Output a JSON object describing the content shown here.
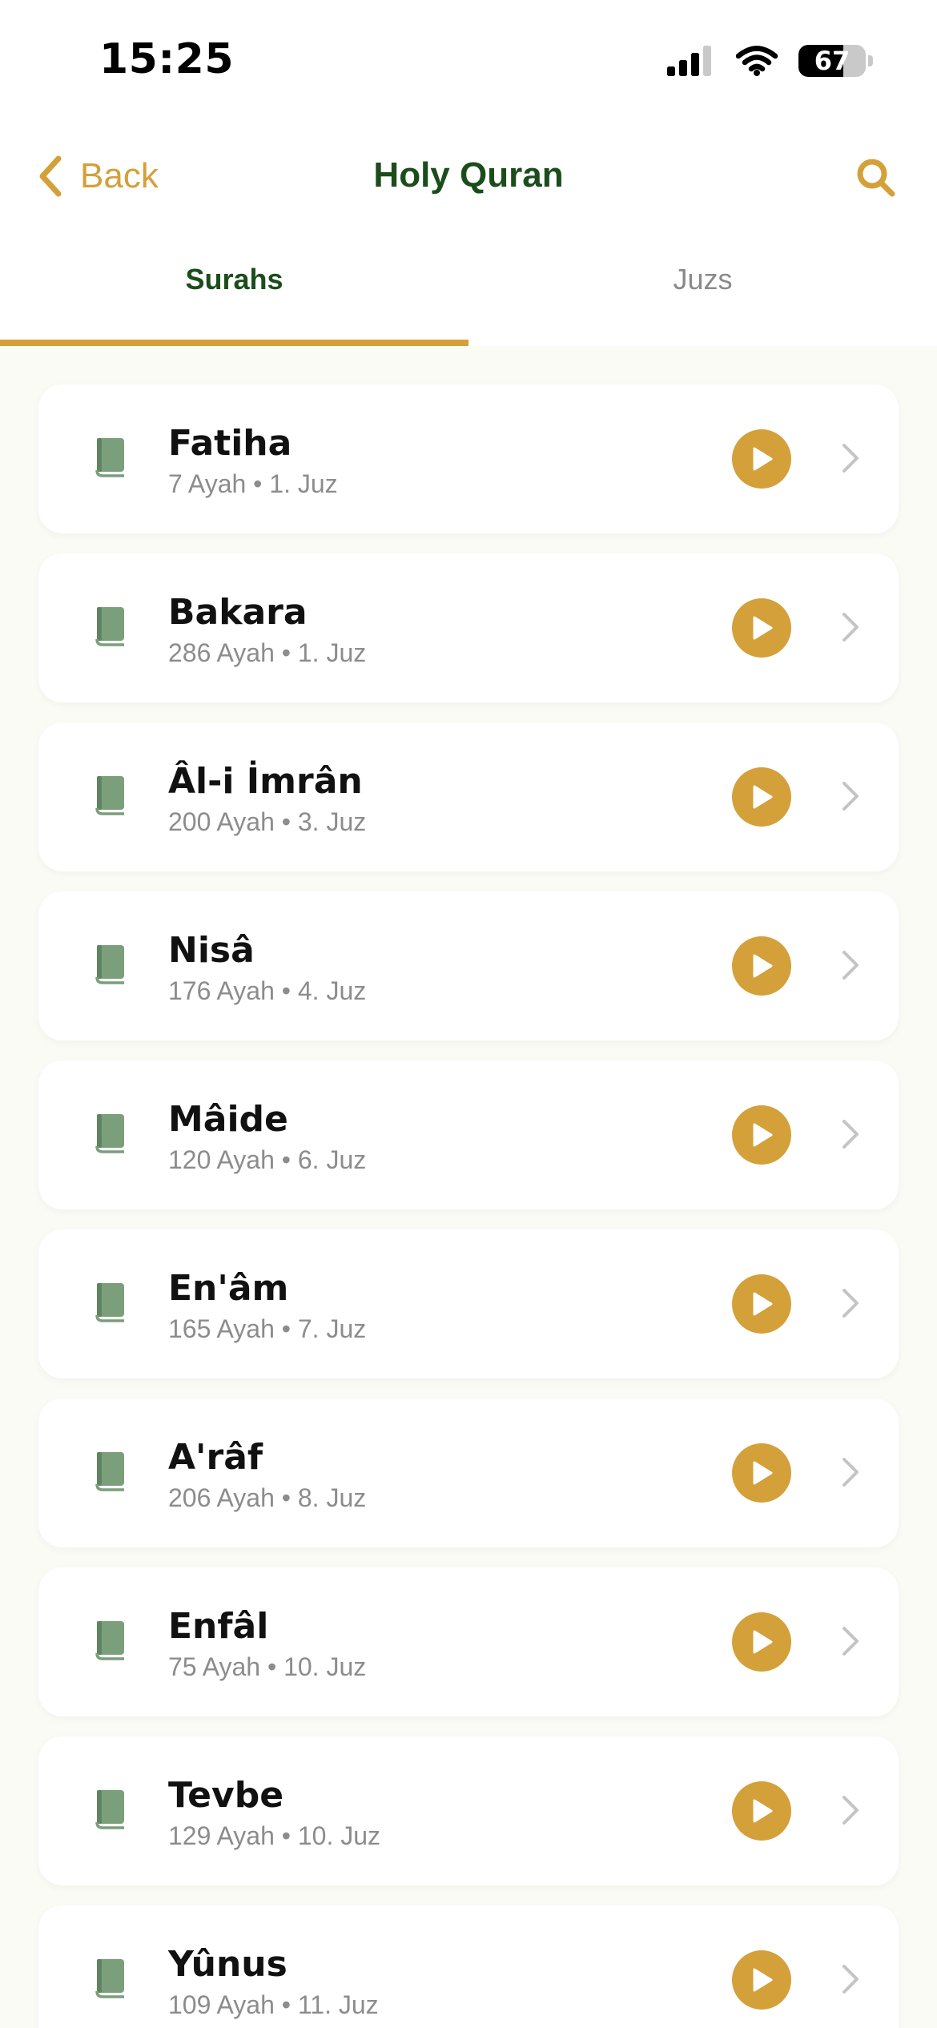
{
  "status_bar": {
    "time": "15:25",
    "battery_percent": "67",
    "battery_level": 0.67
  },
  "nav": {
    "back_label": "Back",
    "title": "Holy Quran",
    "search_icon": "search-icon",
    "back_icon": "chevron-left-icon"
  },
  "tabs": [
    {
      "label": "Surahs",
      "active": true
    },
    {
      "label": "Juzs",
      "active": false
    }
  ],
  "colors": {
    "accent": "#d4a03a",
    "title_green": "#1b4d1b",
    "book_icon": "#7b9e7b",
    "list_background": "#fbfbf6"
  },
  "surahs": [
    {
      "name": "Fatiha",
      "meta": "7 Ayah • 1. Juz"
    },
    {
      "name": "Bakara",
      "meta": "286 Ayah • 1. Juz"
    },
    {
      "name": "Âl-i İmrân",
      "meta": "200 Ayah • 3. Juz"
    },
    {
      "name": "Nisâ",
      "meta": "176 Ayah • 4. Juz"
    },
    {
      "name": "Mâide",
      "meta": "120 Ayah • 6. Juz"
    },
    {
      "name": "En'âm",
      "meta": "165 Ayah • 7. Juz"
    },
    {
      "name": "A'râf",
      "meta": "206 Ayah • 8. Juz"
    },
    {
      "name": "Enfâl",
      "meta": "75 Ayah • 10. Juz"
    },
    {
      "name": "Tevbe",
      "meta": "129 Ayah • 10. Juz"
    },
    {
      "name": "Yûnus",
      "meta": "109 Ayah • 11. Juz"
    }
  ]
}
